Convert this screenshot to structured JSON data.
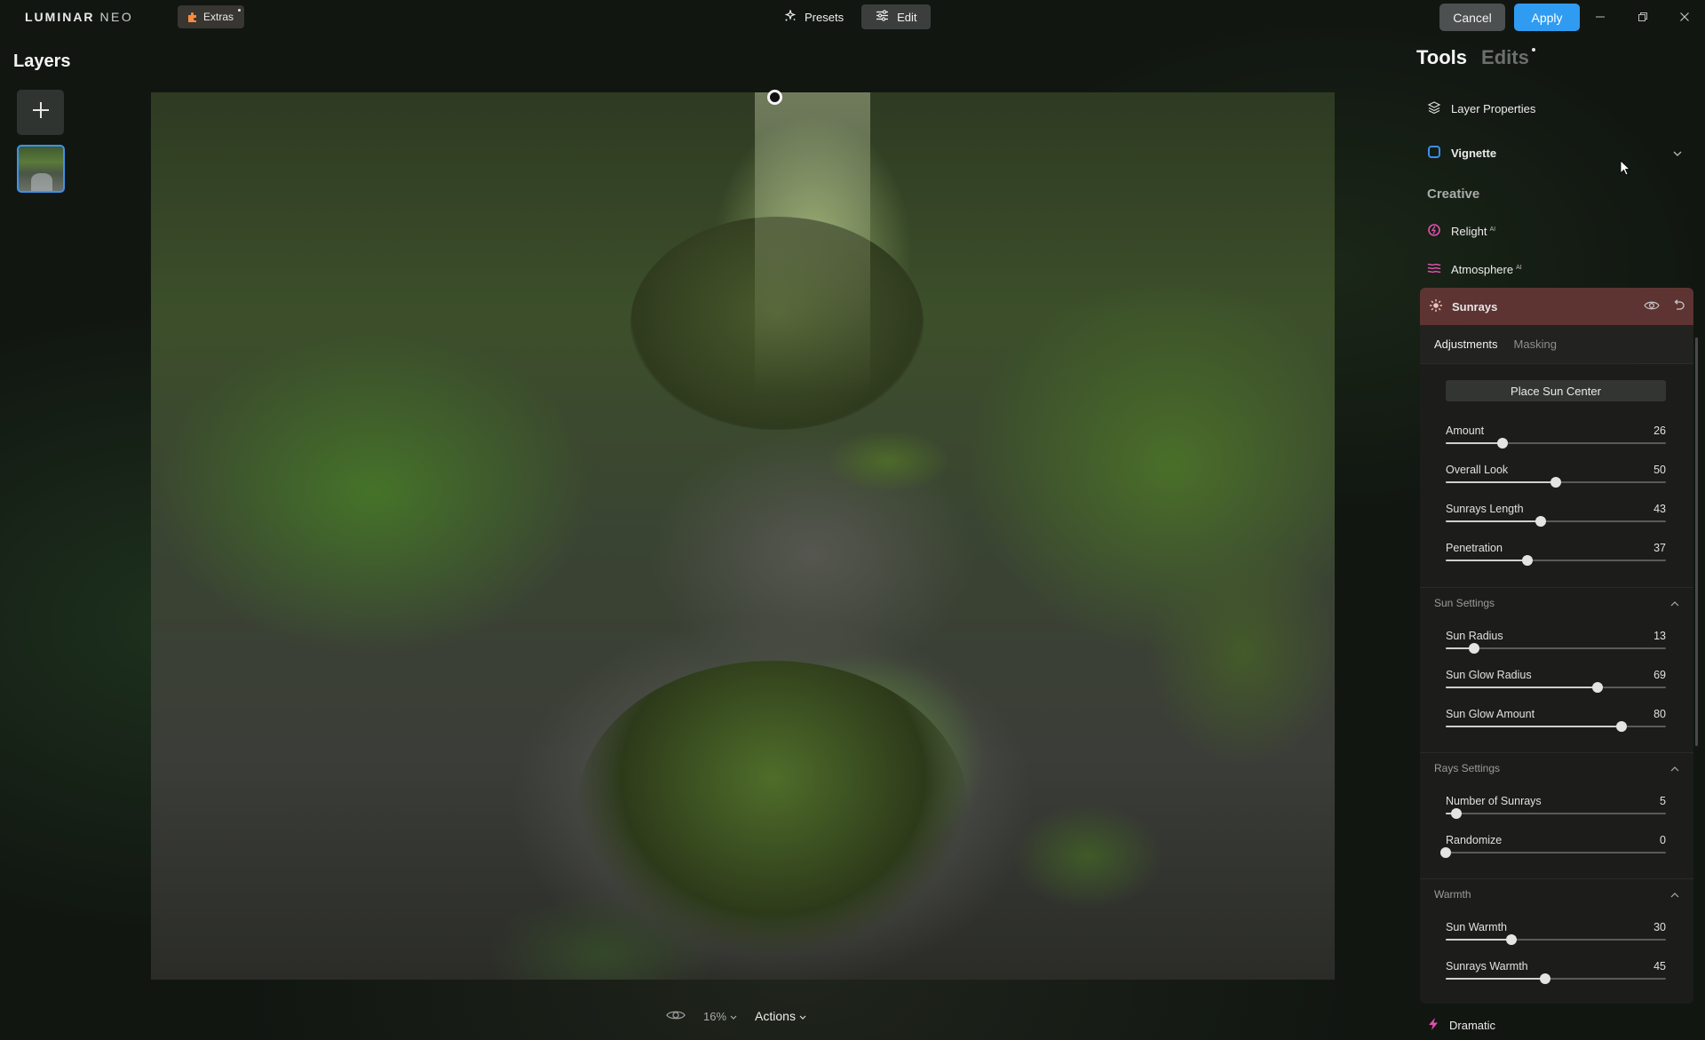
{
  "app": {
    "logo_main": "LUMINAR",
    "logo_accent": "NEO",
    "extras_label": "Extras"
  },
  "topbar": {
    "presets_label": "Presets",
    "edit_label": "Edit",
    "cancel_label": "Cancel",
    "apply_label": "Apply",
    "apply_color": "#2f9cf2"
  },
  "layers": {
    "title": "Layers"
  },
  "canvas": {
    "zoom": "16%",
    "actions_label": "Actions"
  },
  "panel": {
    "tab_tools": "Tools",
    "tab_edits": "Edits",
    "layer_properties": "Layer Properties",
    "vignette": "Vignette",
    "creative_label": "Creative",
    "relight": "Relight",
    "atmosphere": "Atmosphere",
    "ai_badge": "AI",
    "dramatic": "Dramatic",
    "sunrays": {
      "title": "Sunrays",
      "header_color": "#5d3432",
      "tab_adjustments": "Adjustments",
      "tab_masking": "Masking",
      "place_sun_center": "Place Sun Center",
      "main": [
        {
          "label": "Amount",
          "value": "26",
          "pct": 26
        },
        {
          "label": "Overall Look",
          "value": "50",
          "pct": 50
        },
        {
          "label": "Sunrays Length",
          "value": "43",
          "pct": 43
        },
        {
          "label": "Penetration",
          "value": "37",
          "pct": 37
        }
      ],
      "sun_settings": {
        "title": "Sun Settings",
        "sliders": [
          {
            "label": "Sun Radius",
            "value": "13",
            "pct": 13
          },
          {
            "label": "Sun Glow Radius",
            "value": "69",
            "pct": 69
          },
          {
            "label": "Sun Glow Amount",
            "value": "80",
            "pct": 80
          }
        ]
      },
      "rays_settings": {
        "title": "Rays Settings",
        "sliders": [
          {
            "label": "Number of Sunrays",
            "value": "5",
            "pct": 5
          },
          {
            "label": "Randomize",
            "value": "0",
            "pct": 0
          }
        ]
      },
      "warmth": {
        "title": "Warmth",
        "sliders": [
          {
            "label": "Sun Warmth",
            "value": "30",
            "pct": 30
          },
          {
            "label": "Sunrays Warmth",
            "value": "45",
            "pct": 45
          }
        ]
      }
    }
  },
  "icons": {
    "extras": "puzzle-icon",
    "presets": "sparkle-icon",
    "edit": "sliders-icon",
    "layer_properties": "layers-icon",
    "vignette": "vignette-icon",
    "relight": "relight-icon",
    "atmosphere": "atmosphere-icon",
    "sunrays": "sun-icon",
    "dramatic": "lightning-icon"
  }
}
